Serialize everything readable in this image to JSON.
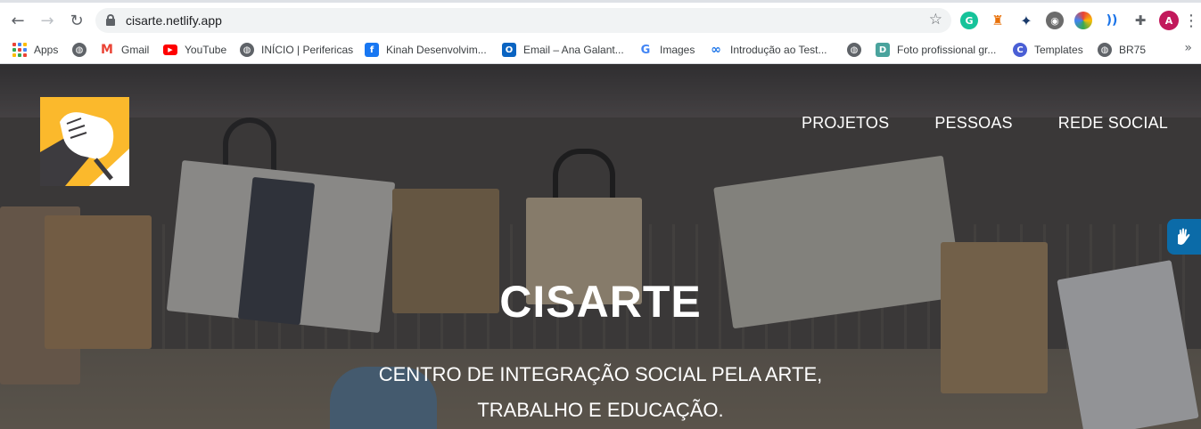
{
  "browser": {
    "url": "cisarte.netlify.app",
    "profile_initial": "A",
    "extensions": [
      {
        "name": "grammarly-icon",
        "letter": "G",
        "color": "#15c39a"
      },
      {
        "name": "rocket-extension-icon",
        "letter": "",
        "color": "#e8710a"
      },
      {
        "name": "puzzle-extension-icon",
        "letter": "",
        "color": "#5f6368"
      }
    ],
    "bookmarks": [
      {
        "label": "Apps",
        "icon": "apps-grid-icon"
      },
      {
        "label": "",
        "icon": "globe-icon"
      },
      {
        "label": "Gmail",
        "icon": "gmail-icon"
      },
      {
        "label": "YouTube",
        "icon": "youtube-icon"
      },
      {
        "label": "INÍCIO | Perifericas",
        "icon": "globe-icon"
      },
      {
        "label": "Kinah Desenvolvim...",
        "icon": "facebook-icon"
      },
      {
        "label": "Email – Ana Galant...",
        "icon": "outlook-icon"
      },
      {
        "label": "Images",
        "icon": "google-icon"
      },
      {
        "label": "Introdução ao Test...",
        "icon": "infinity-icon"
      },
      {
        "label": "",
        "icon": "globe-icon"
      },
      {
        "label": "Foto profissional gr...",
        "icon": "doc-icon"
      },
      {
        "label": "Templates",
        "icon": "templates-icon"
      },
      {
        "label": "BR75",
        "icon": "globe-icon"
      }
    ]
  },
  "site": {
    "nav": [
      "PROJETOS",
      "PESSOAS",
      "REDE SOCIAL"
    ],
    "hero": {
      "title": "CISARTE",
      "subtitle_line1": "CENTRO DE INTEGRAÇÃO SOCIAL PELA ARTE,",
      "subtitle_line2": "TRABALHO E EDUCAÇÃO."
    },
    "colors": {
      "logo_yellow": "#fbb92c",
      "accessibility_blue": "#0b6ba8"
    }
  }
}
